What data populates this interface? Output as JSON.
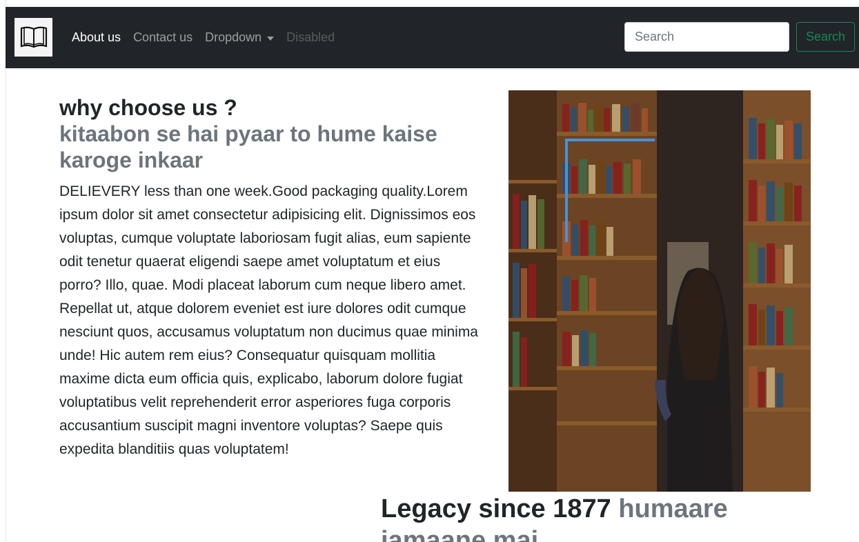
{
  "navbar": {
    "brand_icon": "open-book-icon",
    "links": [
      {
        "label": "About us",
        "state": "active"
      },
      {
        "label": "Contact us",
        "state": "normal"
      },
      {
        "label": "Dropdown",
        "state": "normal"
      },
      {
        "label": "Disabled",
        "state": "disabled"
      }
    ],
    "search_placeholder": "Search",
    "search_button": "Search"
  },
  "feature": {
    "title": "why choose us ?",
    "subtitle": "kitaabon se hai pyaar to hume kaise karoge inkaar",
    "body": "DELIEVERY less than one week.Good packaging quality.Lorem ipsum dolor sit amet consectetur adipisicing elit. Dignissimos eos voluptas, cumque voluptate laboriosam fugit alias, eum sapiente odit tenetur quaerat eligendi saepe amet voluptatum et eius porro? Illo, quae. Modi placeat laborum cum neque libero amet. Repellat ut, atque dolorem eveniet est iure dolores odit cumque nesciunt quos, accusamus voluptatum non ducimus quae minima unde! Hic autem rem eius? Consequatur quisquam mollitia maxime dicta eum officia quis, explicabo, laborum dolore fugiat voluptatibus velit reprehenderit error asperiores fuga corporis accusantium suscipit magni inventore voluptas? Saepe quis expedita blanditiis quas voluptatem!"
  },
  "legacy": {
    "title": "Legacy since 1877",
    "subtitle": "humaare jamaane mai"
  },
  "colors": {
    "navbar_bg": "#212529",
    "muted": "#6c757d",
    "success": "#198754"
  }
}
